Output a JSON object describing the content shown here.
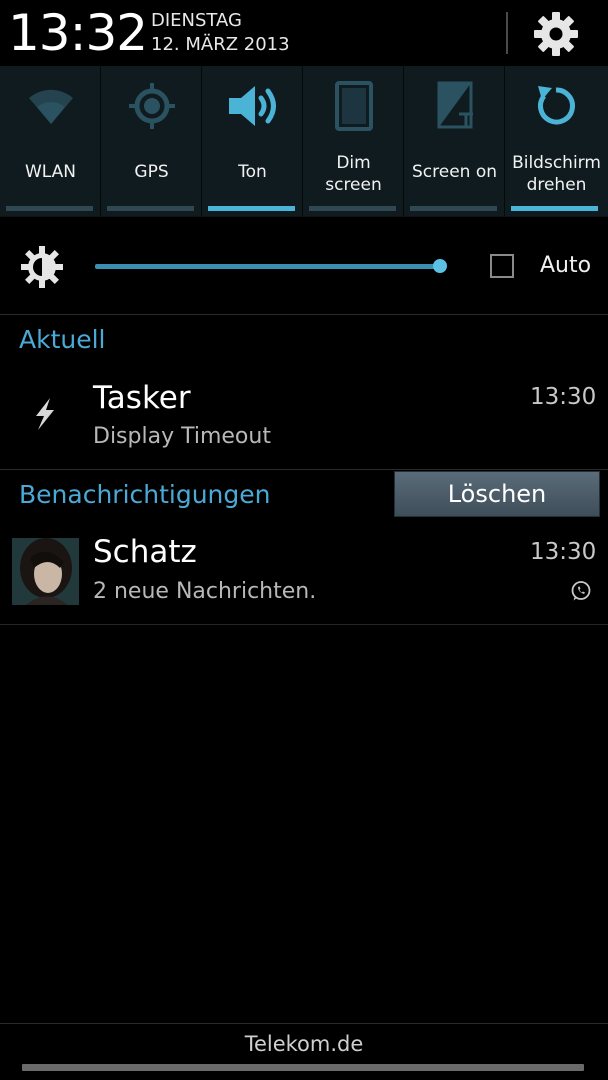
{
  "header": {
    "time": "13:32",
    "day": "DIENSTAG",
    "date": "12. MÄRZ 2013",
    "settings_icon": "gear-icon"
  },
  "toggles": [
    {
      "icon": "wifi-icon",
      "label": "WLAN",
      "active": false
    },
    {
      "icon": "gps-icon",
      "label": "GPS",
      "active": false
    },
    {
      "icon": "volume-icon",
      "label": "Ton",
      "active": true
    },
    {
      "icon": "dim-screen-icon",
      "label_line1": "Dim",
      "label_line2": "screen",
      "active": false
    },
    {
      "icon": "screen-on-icon",
      "label": "Screen on",
      "active": false
    },
    {
      "icon": "rotate-icon",
      "label_line1": "Bildschirm",
      "label_line2": "drehen",
      "active": true
    }
  ],
  "brightness": {
    "icon": "brightness-icon",
    "level": 1.0,
    "auto_checked": false,
    "auto_label": "Auto"
  },
  "ongoing": {
    "header": "Aktuell",
    "item": {
      "icon": "tasker-icon",
      "title": "Tasker",
      "subtitle": "Display Timeout",
      "time": "13:30"
    }
  },
  "notifications": {
    "header": "Benachrichtigungen",
    "clear_label": "Löschen",
    "item": {
      "icon": "avatar",
      "title": "Schatz",
      "subtitle": "2 neue Nachrichten.",
      "time": "13:30",
      "app_icon": "whatsapp-icon"
    }
  },
  "footer": {
    "carrier": "Telekom.de"
  },
  "colors": {
    "accent": "#4aa9d6",
    "tile_bg": "#0f1b1f"
  }
}
